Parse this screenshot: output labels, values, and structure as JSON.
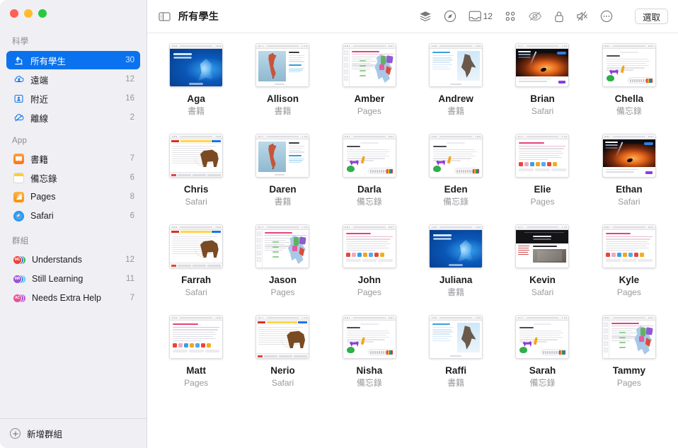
{
  "window": {
    "traffic_lights": [
      "close",
      "minimize",
      "zoom"
    ]
  },
  "toolbar": {
    "sidebar_toggle_icon": "sidebar-toggle-icon",
    "title": "所有學生",
    "actions": [
      {
        "name": "layers",
        "icon": "layers-icon",
        "badge": ""
      },
      {
        "name": "navigate",
        "icon": "compass-icon",
        "badge": ""
      },
      {
        "name": "open-inbox",
        "icon": "inbox-tray-icon",
        "badge": "12"
      },
      {
        "name": "apps-grid",
        "icon": "apps-grid-icon",
        "badge": ""
      },
      {
        "name": "hide-screen",
        "icon": "eye-slash-icon",
        "badge": ""
      },
      {
        "name": "lock-screen",
        "icon": "lock-icon",
        "badge": ""
      },
      {
        "name": "mute",
        "icon": "speaker-mute-icon",
        "badge": ""
      },
      {
        "name": "more-options",
        "icon": "ellipsis-circle-icon",
        "badge": ""
      }
    ],
    "select_label": "選取"
  },
  "sidebar": {
    "sections": [
      {
        "header": "科學",
        "items": [
          {
            "label": "所有學生",
            "count": "30",
            "icon": "microscope-icon",
            "selected": true
          },
          {
            "label": "遠端",
            "count": "12",
            "icon": "cloud-person-icon",
            "selected": false
          },
          {
            "label": "附近",
            "count": "16",
            "icon": "person-frame-icon",
            "selected": false
          },
          {
            "label": "離線",
            "count": "2",
            "icon": "cloud-slash-icon",
            "selected": false
          }
        ]
      },
      {
        "header": "App",
        "items": [
          {
            "label": "書籍",
            "count": "7",
            "icon": "books-app-icon",
            "selected": false
          },
          {
            "label": "備忘錄",
            "count": "6",
            "icon": "notes-app-icon",
            "selected": false
          },
          {
            "label": "Pages",
            "count": "8",
            "icon": "pages-app-icon",
            "selected": false
          },
          {
            "label": "Safari",
            "count": "6",
            "icon": "safari-app-icon",
            "selected": false
          }
        ]
      },
      {
        "header": "群組",
        "items": [
          {
            "label": "Understands",
            "count": "12",
            "icon": "group-avatars-icon",
            "initials": "MC",
            "color": "#ef4136",
            "color2": "#31b44b",
            "color3": "#2f7fe0",
            "selected": false
          },
          {
            "label": "Still Learning",
            "count": "11",
            "icon": "group-avatars-icon",
            "initials": "MR",
            "color": "#9b51e0",
            "color2": "#2f9fe0",
            "color3": "#5ac8fa",
            "selected": false
          },
          {
            "label": "Needs Extra Help",
            "count": "7",
            "icon": "group-avatars-icon",
            "initials": "AC",
            "color": "#e8519b",
            "color2": "#9b51e0",
            "color3": "#c04fd0",
            "selected": false
          }
        ]
      }
    ],
    "add_group_label": "新增群組"
  },
  "main": {
    "students": [
      {
        "name": "Aga",
        "app": "書籍",
        "art": "whale"
      },
      {
        "name": "Allison",
        "app": "書籍",
        "art": "flamingo"
      },
      {
        "name": "Amber",
        "app": "Pages",
        "art": "map"
      },
      {
        "name": "Andrew",
        "app": "書籍",
        "art": "bird"
      },
      {
        "name": "Brian",
        "app": "Safari",
        "art": "space"
      },
      {
        "name": "Chella",
        "app": "備忘錄",
        "art": "notes"
      },
      {
        "name": "Chris",
        "app": "Safari",
        "art": "mammoth"
      },
      {
        "name": "Daren",
        "app": "書籍",
        "art": "flamingo"
      },
      {
        "name": "Darla",
        "app": "備忘錄",
        "art": "notes"
      },
      {
        "name": "Eden",
        "app": "備忘錄",
        "art": "notes"
      },
      {
        "name": "Elie",
        "app": "Pages",
        "art": "pages"
      },
      {
        "name": "Ethan",
        "app": "Safari",
        "art": "space"
      },
      {
        "name": "Farrah",
        "app": "Safari",
        "art": "mammoth"
      },
      {
        "name": "Jason",
        "app": "Pages",
        "art": "map"
      },
      {
        "name": "John",
        "app": "Pages",
        "art": "pages"
      },
      {
        "name": "Juliana",
        "app": "書籍",
        "art": "whale"
      },
      {
        "name": "Kevin",
        "app": "Safari",
        "art": "shake"
      },
      {
        "name": "Kyle",
        "app": "Pages",
        "art": "pages"
      },
      {
        "name": "Matt",
        "app": "Pages",
        "art": "pages"
      },
      {
        "name": "Nerio",
        "app": "Safari",
        "art": "mammoth"
      },
      {
        "name": "Nisha",
        "app": "備忘錄",
        "art": "notes"
      },
      {
        "name": "Raffi",
        "app": "書籍",
        "art": "bird"
      },
      {
        "name": "Sarah",
        "app": "備忘錄",
        "art": "notes"
      },
      {
        "name": "Tammy",
        "app": "Pages",
        "art": "map"
      }
    ]
  },
  "colors": {
    "accent": "#0a72ee",
    "sidebar_bg": "#f0eff3",
    "content_bg": "#ffffff",
    "secondary_text": "#9a9a9f"
  }
}
